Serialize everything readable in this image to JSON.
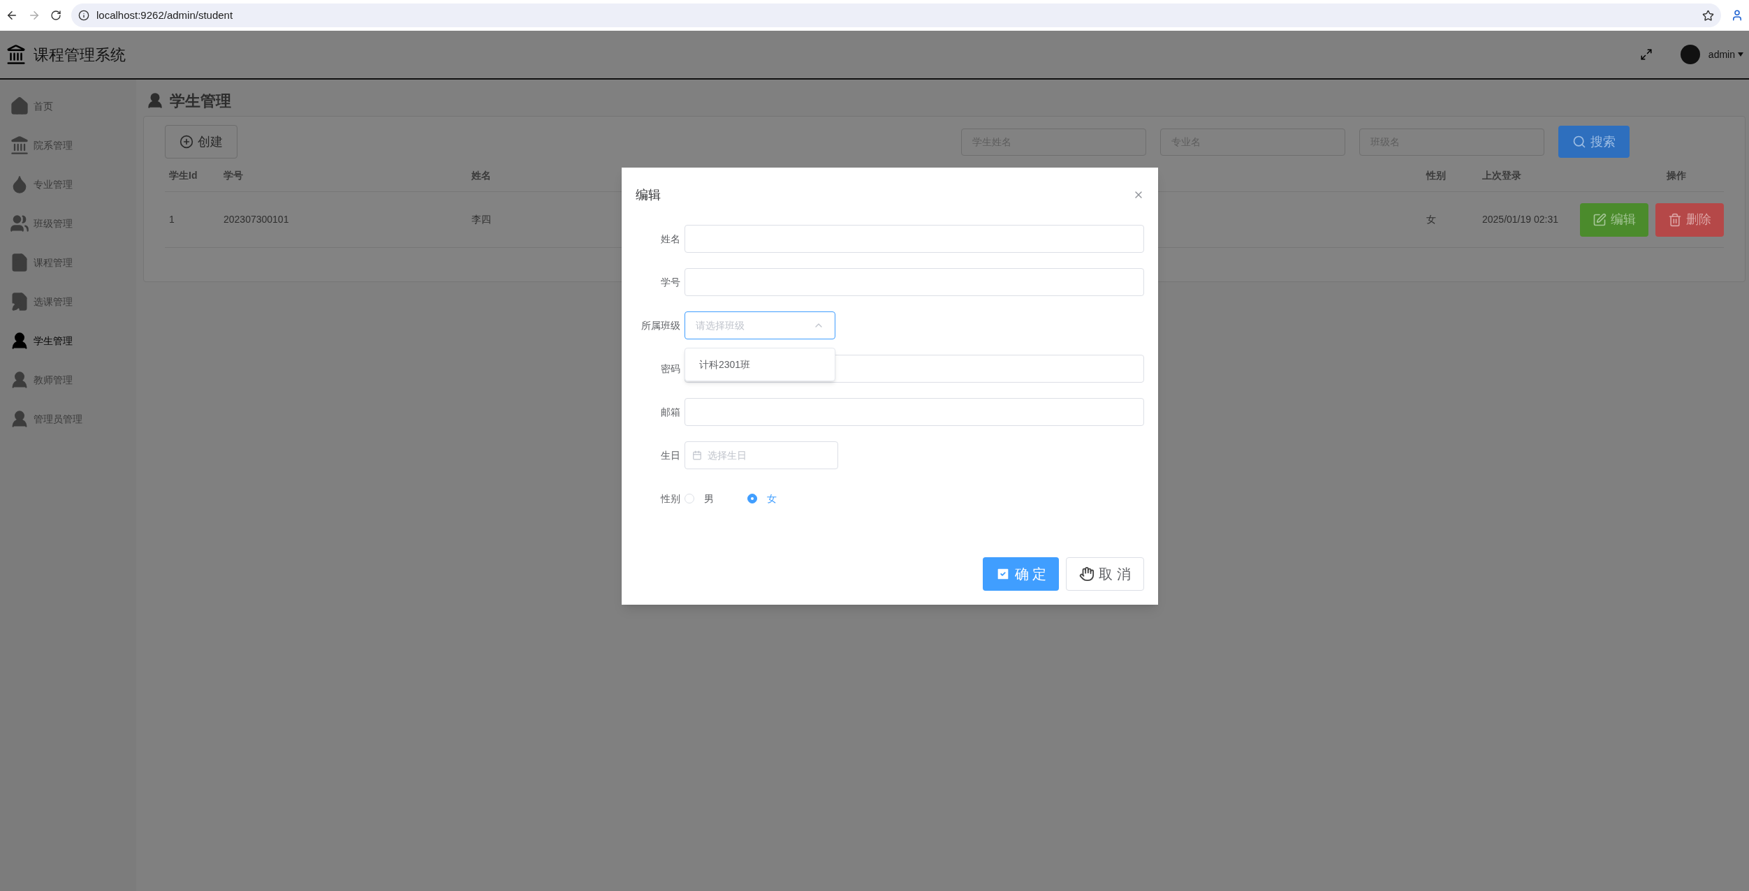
{
  "browser": {
    "url": "localhost:9262/admin/student"
  },
  "header": {
    "title": "课程管理系统",
    "user": "admin"
  },
  "sidebar": {
    "items": [
      {
        "label": "首页",
        "selected": false
      },
      {
        "label": "院系管理",
        "selected": false
      },
      {
        "label": "专业管理",
        "selected": false
      },
      {
        "label": "班级管理",
        "selected": false
      },
      {
        "label": "课程管理",
        "selected": false
      },
      {
        "label": "选课管理",
        "selected": false
      },
      {
        "label": "学生管理",
        "selected": true
      },
      {
        "label": "教师管理",
        "selected": false
      },
      {
        "label": "管理员管理",
        "selected": false
      }
    ]
  },
  "page_title": "学生管理",
  "toolbar": {
    "create_button": "创建",
    "search_fields": [
      {
        "placeholder": "学生姓名"
      },
      {
        "placeholder": "专业名"
      },
      {
        "placeholder": "班级名"
      }
    ],
    "search_button": "搜索"
  },
  "table": {
    "columns": [
      "学生Id",
      "学号",
      "姓名",
      "性别",
      "上次登录",
      "操作"
    ],
    "rows": [
      {
        "cells": [
          "1",
          "202307300101",
          "李四",
          "女",
          "2025/01/19 02:31"
        ],
        "actions": [
          {
            "kind": "edit",
            "label": "编辑"
          },
          {
            "kind": "delete",
            "label": "删除"
          }
        ]
      }
    ]
  },
  "dialog": {
    "title": "编辑",
    "fields": [
      {
        "kind": "text",
        "label": "姓名"
      },
      {
        "kind": "text",
        "label": "学号"
      },
      {
        "kind": "select",
        "label": "所属班级",
        "placeholder": "请选择班级",
        "expanded": true,
        "options": [
          "计科2301班"
        ]
      },
      {
        "kind": "text",
        "label": "密码"
      },
      {
        "kind": "text",
        "label": "邮箱"
      },
      {
        "kind": "date",
        "label": "生日",
        "placeholder": "选择生日"
      },
      {
        "kind": "radio",
        "label": "性别",
        "options": [
          {
            "label": "男",
            "selected": false
          },
          {
            "label": "女",
            "selected": true
          }
        ]
      }
    ],
    "buttons": [
      {
        "kind": "primary",
        "label": "确 定"
      },
      {
        "kind": "default",
        "label": "取 消"
      }
    ]
  }
}
